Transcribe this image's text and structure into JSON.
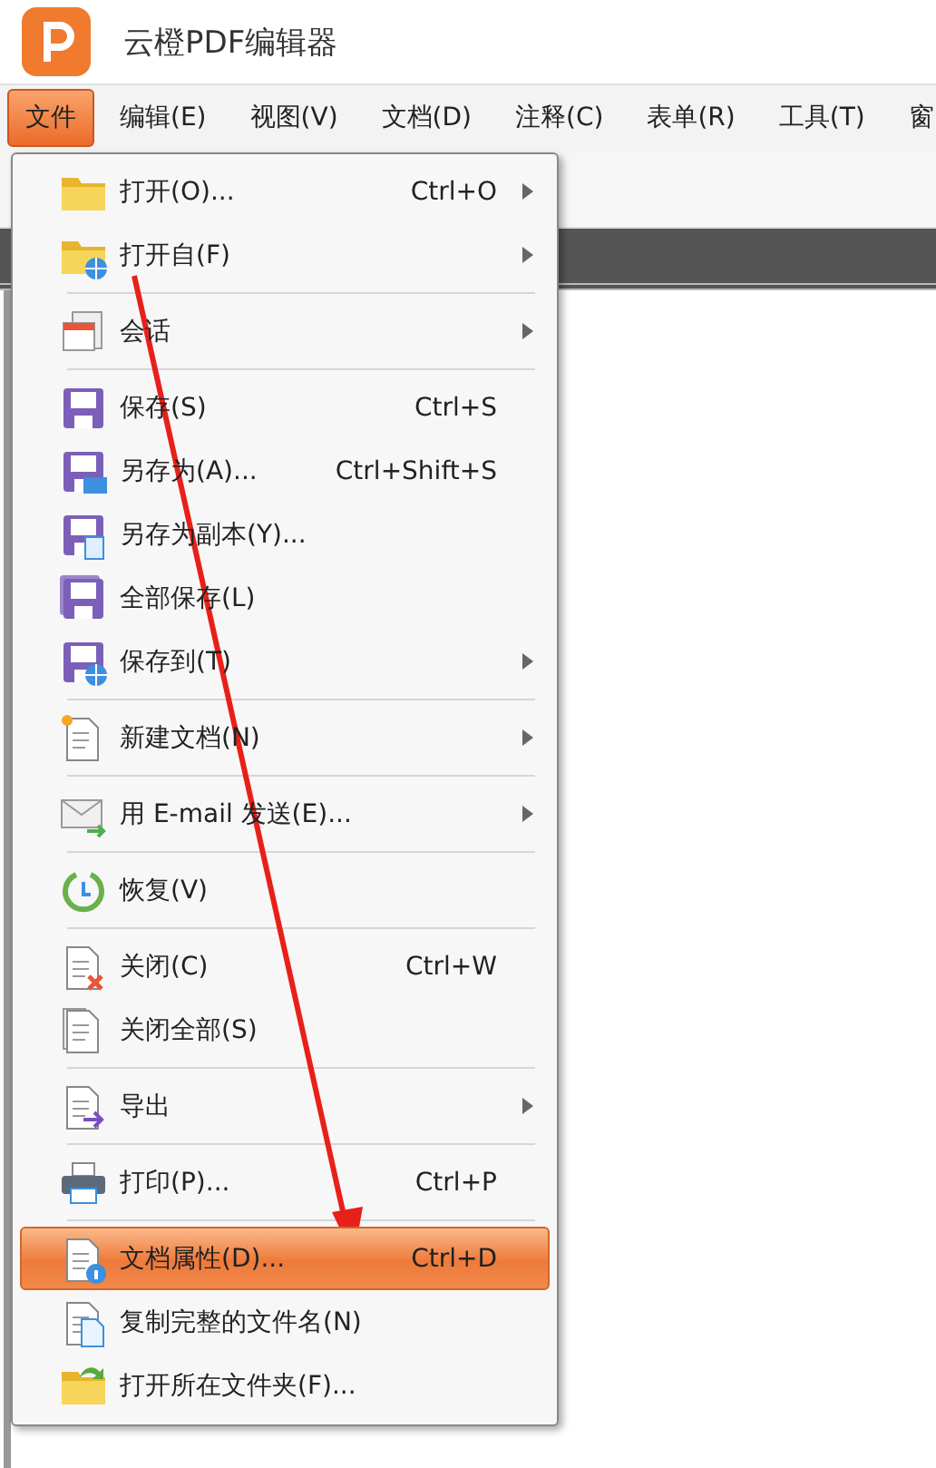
{
  "window": {
    "title": "云橙PDF编辑器"
  },
  "menubar": [
    {
      "label": "文件",
      "selected": true
    },
    {
      "label": "编辑(E)",
      "selected": false
    },
    {
      "label": "视图(V)",
      "selected": false
    },
    {
      "label": "文档(D)",
      "selected": false
    },
    {
      "label": "注释(C)",
      "selected": false
    },
    {
      "label": "表单(R)",
      "selected": false
    },
    {
      "label": "工具(T)",
      "selected": false
    },
    {
      "label": "窗",
      "selected": false
    }
  ],
  "file_menu": [
    {
      "kind": "item",
      "label": "打开(O)...",
      "shortcut": "Ctrl+O",
      "submenu": true,
      "selected": false
    },
    {
      "kind": "item",
      "label": "打开自(F)",
      "submenu": true,
      "selected": false
    },
    {
      "kind": "separator"
    },
    {
      "kind": "item",
      "label": "会话",
      "submenu": true,
      "selected": false
    },
    {
      "kind": "separator"
    },
    {
      "kind": "item",
      "label": "保存(S)",
      "shortcut": "Ctrl+S",
      "submenu": false,
      "selected": false
    },
    {
      "kind": "item",
      "label": "另存为(A)...",
      "shortcut": "Ctrl+Shift+S",
      "submenu": false,
      "selected": false
    },
    {
      "kind": "item",
      "label": "另存为副本(Y)...",
      "submenu": false,
      "selected": false
    },
    {
      "kind": "item",
      "label": "全部保存(L)",
      "submenu": false,
      "selected": false
    },
    {
      "kind": "item",
      "label": "保存到(T)",
      "submenu": true,
      "selected": false
    },
    {
      "kind": "separator"
    },
    {
      "kind": "item",
      "label": "新建文档(N)",
      "submenu": true,
      "selected": false
    },
    {
      "kind": "separator"
    },
    {
      "kind": "item",
      "label": "用 E-mail 发送(E)...",
      "submenu": true,
      "selected": false
    },
    {
      "kind": "separator"
    },
    {
      "kind": "item",
      "label": "恢复(V)",
      "submenu": false,
      "selected": false
    },
    {
      "kind": "separator"
    },
    {
      "kind": "item",
      "label": "关闭(C)",
      "shortcut": "Ctrl+W",
      "submenu": false,
      "selected": false
    },
    {
      "kind": "item",
      "label": "关闭全部(S)",
      "submenu": false,
      "selected": false
    },
    {
      "kind": "separator"
    },
    {
      "kind": "item",
      "label": "导出",
      "submenu": true,
      "selected": false
    },
    {
      "kind": "separator"
    },
    {
      "kind": "item",
      "label": "打印(P)...",
      "shortcut": "Ctrl+P",
      "submenu": false,
      "selected": false
    },
    {
      "kind": "separator"
    },
    {
      "kind": "item",
      "label": "文档属性(D)...",
      "shortcut": "Ctrl+D",
      "submenu": false,
      "selected": true
    },
    {
      "kind": "item",
      "label": "复制完整的文件名(N)",
      "submenu": false,
      "selected": false
    },
    {
      "kind": "item",
      "label": "打开所在文件夹(F)...",
      "submenu": false,
      "selected": false
    }
  ]
}
